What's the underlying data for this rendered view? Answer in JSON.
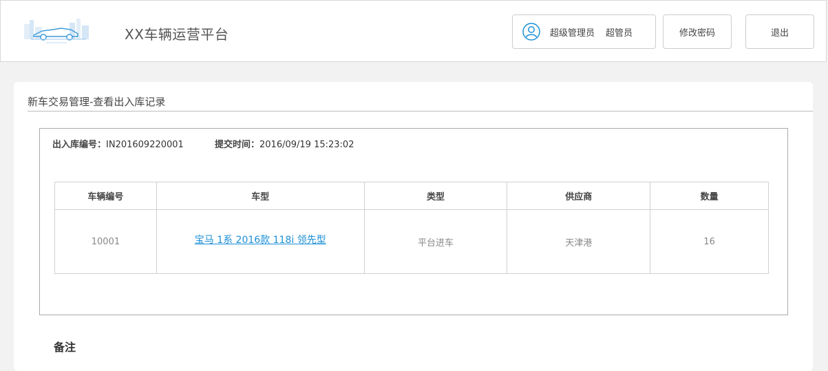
{
  "header": {
    "app_title": "XX车辆运营平台",
    "user_role": "超级管理员",
    "user_name": "超管员",
    "change_password_label": "修改密码",
    "logout_label": "退出"
  },
  "page": {
    "title": "新车交易管理-查看出入库记录"
  },
  "record": {
    "id_label": "出入库编号：",
    "id_value": "IN201609220001",
    "time_label": "提交时间：",
    "time_value": "2016/09/19  15:23:02"
  },
  "table": {
    "columns": [
      "车辆编号",
      "车型",
      "类型",
      "供应商",
      "数量"
    ],
    "rows": [
      {
        "vehicle_id": "10001",
        "model": "宝马 1系  2016款 118i 领先型",
        "type": "平台进车",
        "supplier": "天津港",
        "quantity": "16"
      }
    ]
  },
  "remarks_label": "备注",
  "colors": {
    "accent_blue": "#1b8fd6",
    "border": "#d0d0d0",
    "background": "#f2f2f2"
  }
}
